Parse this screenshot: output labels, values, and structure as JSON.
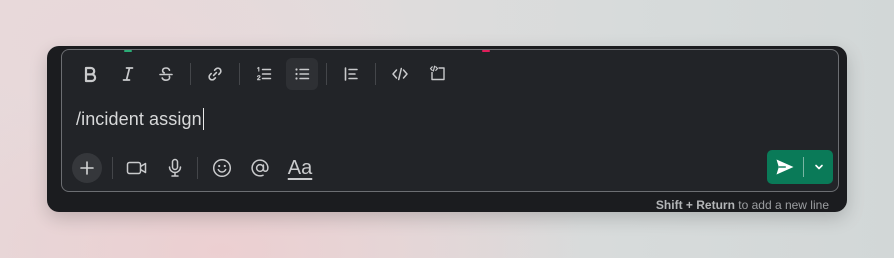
{
  "colors": {
    "card_background": "#1b1c1f",
    "composer_background": "#222428",
    "composer_border": "#6c6e72",
    "icon": "#c9cacc",
    "send_button": "#0a7a58",
    "peek_green": "#2bac76",
    "peek_red": "#e01e5a"
  },
  "toolbar": {
    "items": [
      {
        "icon": "bold-icon",
        "active": false
      },
      {
        "icon": "italic-icon",
        "active": false
      },
      {
        "icon": "strikethrough-icon",
        "active": false
      },
      {
        "icon": "link-icon",
        "active": false
      },
      {
        "icon": "ordered-list-icon",
        "active": false
      },
      {
        "icon": "bulleted-list-icon",
        "active": true
      },
      {
        "icon": "blockquote-icon",
        "active": false
      },
      {
        "icon": "code-icon",
        "active": false
      },
      {
        "icon": "code-block-icon",
        "active": false
      }
    ]
  },
  "message": {
    "value": "/incident assign"
  },
  "bottom_bar": {
    "items": [
      {
        "icon": "plus-icon"
      },
      {
        "icon": "video-icon"
      },
      {
        "icon": "microphone-icon"
      },
      {
        "icon": "emoji-icon"
      },
      {
        "icon": "mention-icon"
      },
      {
        "icon": "formatting-icon",
        "label": "Aa"
      }
    ]
  },
  "send": {
    "icon": "send-icon",
    "options_icon": "chevron-down-icon"
  },
  "hint": {
    "key": "Shift + Return",
    "text": " to add a new line"
  }
}
